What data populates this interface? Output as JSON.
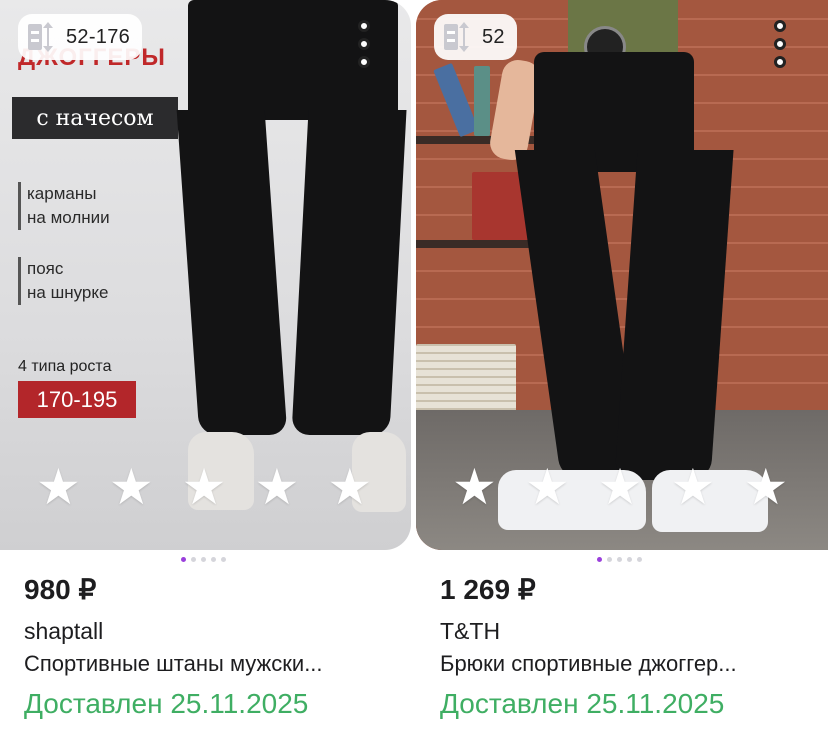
{
  "products": [
    {
      "size_badge": "52-176",
      "promo": {
        "headline": "ДЖОГГЕРЫ",
        "box": "с начесом",
        "features": [
          "карманы\nна молнии",
          "пояс\nна шнурке"
        ],
        "growth": "4 типа роста",
        "range": "170-195"
      },
      "rating_stars": 5,
      "carousel_dots": 5,
      "price": "980 ₽",
      "brand": "shaptall",
      "title": "Спортивные штаны мужски...",
      "delivery": "Доставлен 25.11.2025"
    },
    {
      "size_badge": "52",
      "rating_stars": 5,
      "carousel_dots": 5,
      "price": "1 269 ₽",
      "brand": "T&TH",
      "title": "Брюки спортивные джоггер...",
      "delivery": "Доставлен 25.11.2025"
    }
  ],
  "colors": {
    "delivery_green": "#3fae63",
    "carousel_active": "#9a3fdc",
    "promo_red": "#b3262a"
  },
  "icons": {
    "size": "size-ruler-icon",
    "more": "more-vertical-icon",
    "star": "star-icon"
  }
}
